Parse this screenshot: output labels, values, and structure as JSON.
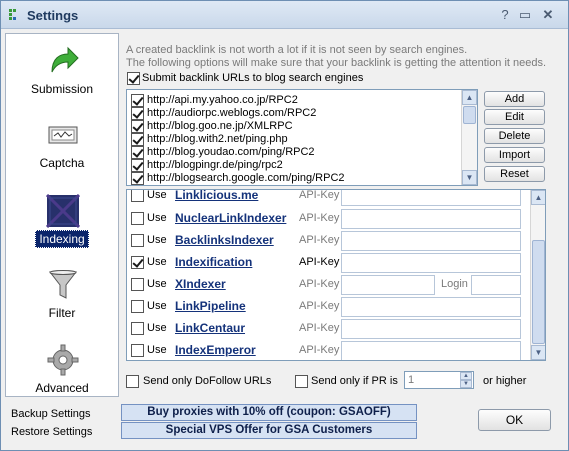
{
  "window": {
    "title": "Settings"
  },
  "sidebar": {
    "items": [
      {
        "label": "Submission",
        "icon": "green-arrow-icon",
        "selected": false
      },
      {
        "label": "Captcha",
        "icon": "captcha-icon",
        "selected": false
      },
      {
        "label": "Indexing",
        "icon": "indexing-icon",
        "selected": true
      },
      {
        "label": "Filter",
        "icon": "funnel-icon",
        "selected": false
      },
      {
        "label": "Advanced",
        "icon": "gear-icon",
        "selected": false
      }
    ]
  },
  "main": {
    "description_line1": "A created backlink is not worth a lot if it is not seen by search engines.",
    "description_line2": "The following options will make sure that your backlink is getting the attention it needs.",
    "submit_label": "Submit backlink URLs to blog search engines",
    "submit_checked": true,
    "urls": [
      "http://api.my.yahoo.co.jp/RPC2",
      "http://audiorpc.weblogs.com/RPC2",
      "http://blog.goo.ne.jp/XMLRPC",
      "http://blog.with2.net/ping.php",
      "http://blog.youdao.com/ping/RPC2",
      "http://blogpingr.de/ping/rpc2",
      "http://blogsearch.google.com/ping/RPC2"
    ],
    "buttons": {
      "add": "Add",
      "edit": "Edit",
      "delete": "Delete",
      "import": "Import",
      "reset": "Reset"
    },
    "use_label": "Use",
    "api_key_label": "API-Key",
    "login_label": "Login",
    "indexers": [
      {
        "name": "Linklicious.me",
        "checked": false
      },
      {
        "name": "NuclearLinkIndexer",
        "checked": false
      },
      {
        "name": "BacklinksIndexer",
        "checked": false
      },
      {
        "name": "Indexification",
        "checked": true
      },
      {
        "name": "XIndexer",
        "checked": false
      },
      {
        "name": "LinkPipeline",
        "checked": false
      },
      {
        "name": "LinkCentaur",
        "checked": false
      },
      {
        "name": "IndexEmperor",
        "checked": false
      }
    ],
    "dofollow_label": "Send only DoFollow URLs",
    "pr_label": "Send only if PR is",
    "pr_value": "1",
    "higher_label": "or higher"
  },
  "footer": {
    "backup": "Backup Settings",
    "restore": "Restore Settings",
    "promo1": "Buy proxies with 10% off  (coupon: GSAOFF)",
    "promo2": "Special VPS Offer for GSA Customers",
    "ok": "OK"
  }
}
